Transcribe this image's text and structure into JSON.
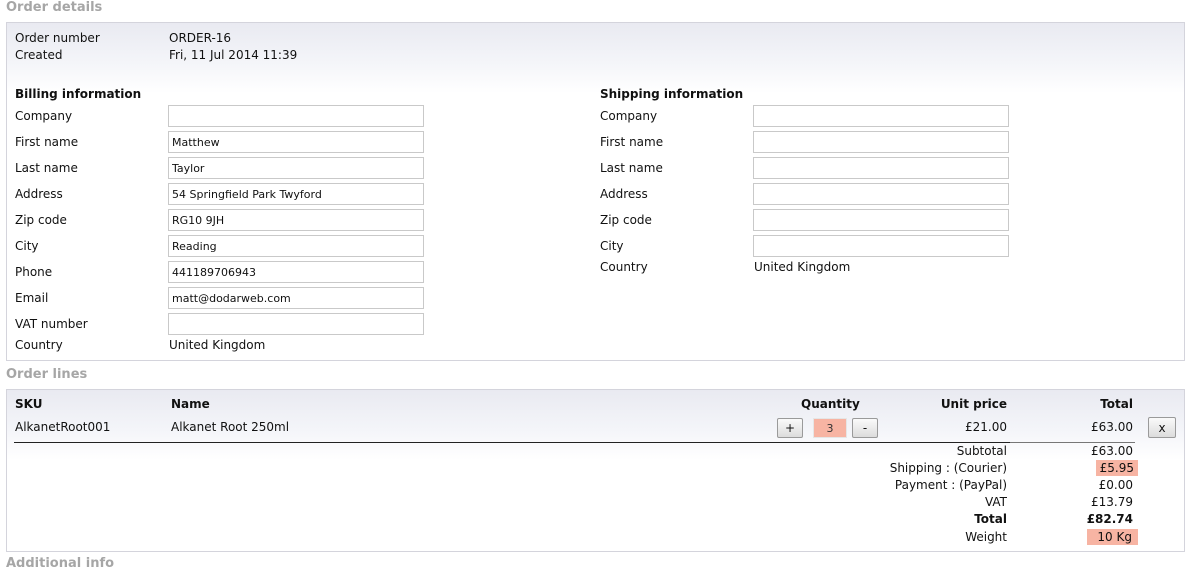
{
  "sections": {
    "order_details": "Order details",
    "order_lines": "Order lines",
    "additional_info": "Additional info"
  },
  "order": {
    "number_label": "Order number",
    "number": "ORDER-16",
    "created_label": "Created",
    "created": "Fri, 11 Jul 2014 11:39"
  },
  "billing": {
    "title": "Billing information",
    "company_label": "Company",
    "company": "",
    "first_name_label": "First name",
    "first_name": "Matthew",
    "last_name_label": "Last name",
    "last_name": "Taylor",
    "address_label": "Address",
    "address": "54 Springfield Park Twyford",
    "zip_label": "Zip code",
    "zip": "RG10 9JH",
    "city_label": "City",
    "city": "Reading",
    "phone_label": "Phone",
    "phone": "441189706943",
    "email_label": "Email",
    "email": "matt@dodarweb.com",
    "vat_label": "VAT number",
    "vat": "",
    "country_label": "Country",
    "country": "United Kingdom"
  },
  "shipping": {
    "title": "Shipping information",
    "company_label": "Company",
    "company": "",
    "first_name_label": "First name",
    "first_name": "",
    "last_name_label": "Last name",
    "last_name": "",
    "address_label": "Address",
    "address": "",
    "zip_label": "Zip code",
    "zip": "",
    "city_label": "City",
    "city": "",
    "country_label": "Country",
    "country": "United Kingdom"
  },
  "lines": {
    "headers": {
      "sku": "SKU",
      "name": "Name",
      "quantity": "Quantity",
      "unit_price": "Unit price",
      "total": "Total"
    },
    "items": [
      {
        "sku": "AlkanetRoot001",
        "name": "Alkanet Root 250ml",
        "quantity": "3",
        "unit_price": "£21.00",
        "total": "£63.00",
        "plus": "+",
        "minus": "-",
        "remove": "x"
      }
    ]
  },
  "summary": {
    "subtotal_label": "Subtotal",
    "subtotal": "£63.00",
    "shipping_label": "Shipping : (Courier)",
    "shipping": "£5.95",
    "payment_label": "Payment : (PayPal)",
    "payment": "£0.00",
    "vat_label": "VAT",
    "vat": "£13.79",
    "total_label": "Total",
    "total": "£82.74",
    "weight_label": "Weight",
    "weight": "10 Kg"
  },
  "colors": {
    "highlight": "#f7b4a3",
    "section_title": "#a6a6a6",
    "panel_border": "#d4d4dc"
  }
}
